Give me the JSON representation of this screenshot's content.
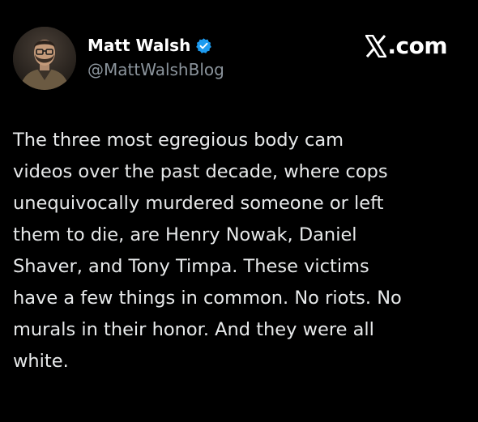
{
  "author": {
    "display_name": "Matt Walsh",
    "handle": "@MattWalshBlog",
    "verified": true,
    "verified_color": "#1d9bf0"
  },
  "brand": {
    "text": ".com",
    "logo": "x-logo-icon"
  },
  "tweet": {
    "text": "The three most egregious body cam\nvideos over the past decade, where cops\nunequivocally murdered someone or left\nthem to die, are Henry Nowak, Daniel\nShaver, and Tony Timpa. These victims\nhave a few things in common. No riots. No\nmurals in their honor. And they were all\nwhite."
  },
  "colors": {
    "background": "#000000",
    "primary_text": "#e7e9ea",
    "secondary_text": "#8b949c"
  }
}
